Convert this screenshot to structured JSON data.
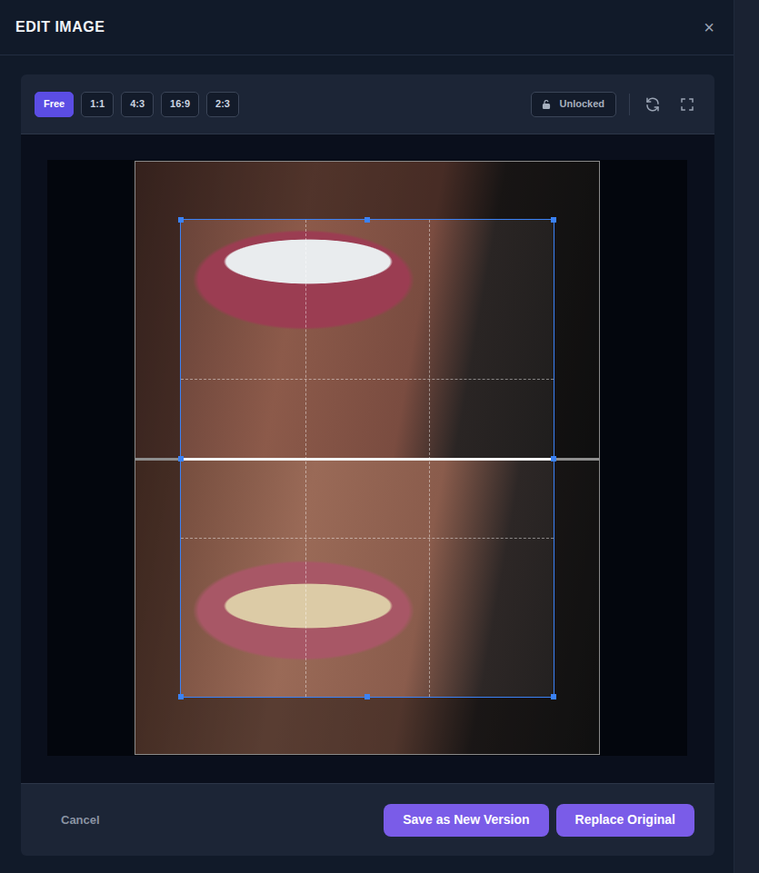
{
  "dialog": {
    "title": "EDIT IMAGE",
    "close": "×"
  },
  "aspect_ratios": [
    {
      "label": "Free",
      "selected": true
    },
    {
      "label": "1:1",
      "selected": false
    },
    {
      "label": "4:3",
      "selected": false
    },
    {
      "label": "16:9",
      "selected": false
    },
    {
      "label": "2:3",
      "selected": false
    }
  ],
  "lock": {
    "label": "Unlocked",
    "locked": false
  },
  "footer": {
    "cancel": "Cancel",
    "save_new": "Save as New Version",
    "replace": "Replace Original"
  }
}
